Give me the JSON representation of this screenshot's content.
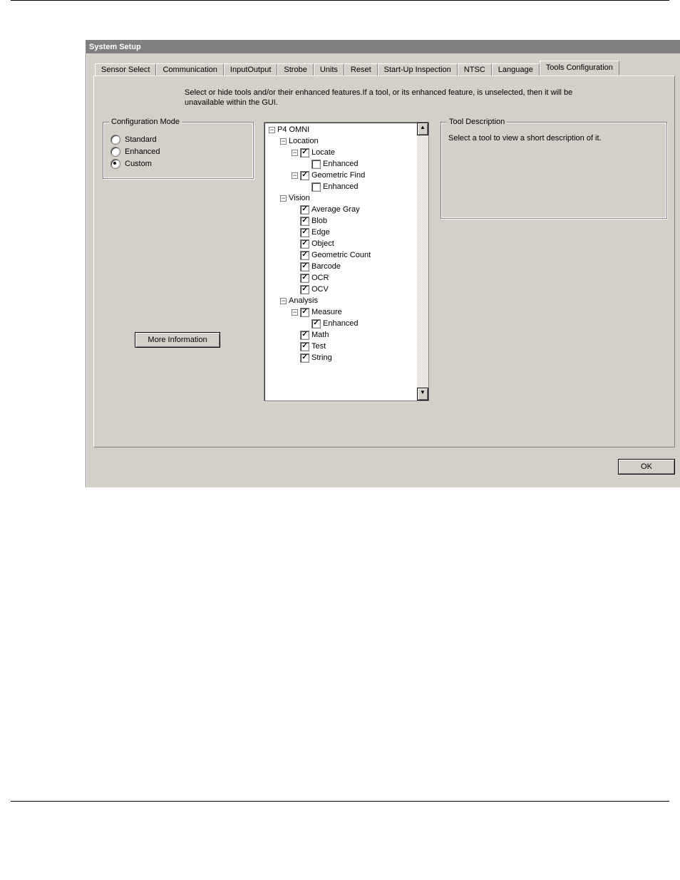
{
  "window_title": "System  Setup",
  "tabs": [
    "Sensor Select",
    "Communication",
    "InputOutput",
    "Strobe",
    "Units",
    "Reset",
    "Start-Up Inspection",
    "NTSC",
    "Language",
    "Tools Configuration"
  ],
  "active_tab_index": 9,
  "instructions": "Select or hide tools and/or their enhanced features.If a tool, or its enhanced feature, is unselected, then it will be unavailable within the GUI.",
  "config_mode": {
    "legend": "Configuration Mode",
    "options": [
      "Standard",
      "Enhanced",
      "Custom"
    ],
    "selected_index": 2
  },
  "more_info_label": "More Information",
  "tool_description": {
    "legend": "Tool Description",
    "text": "Select a tool to view a short description of it."
  },
  "ok_label": "OK",
  "tree": {
    "root": "P4 OMNI",
    "location_label": "Location",
    "locate": "Locate",
    "locate_enh": "Enhanced",
    "geofind": "Geometric Find",
    "geofind_enh": "Enhanced",
    "vision_label": "Vision",
    "avg_gray": "Average Gray",
    "blob": "Blob",
    "edge": "Edge",
    "object": "Object",
    "geocount": "Geometric Count",
    "barcode": "Barcode",
    "ocr": "OCR",
    "ocv": "OCV",
    "analysis_label": "Analysis",
    "measure": "Measure",
    "measure_enh": "Enhanced",
    "math": "Math",
    "test": "Test",
    "string": "String"
  }
}
